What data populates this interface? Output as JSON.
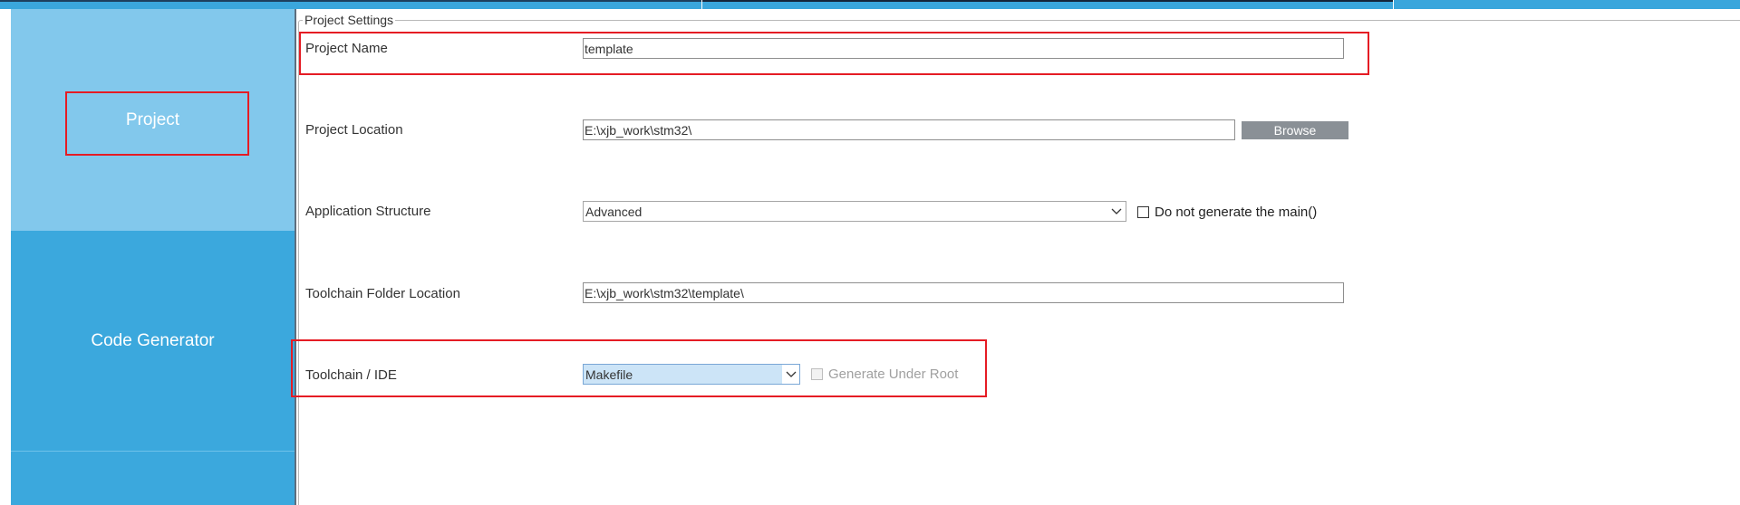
{
  "sidebar": {
    "tabs": [
      {
        "label": "Project",
        "active": true
      },
      {
        "label": "Code Generator",
        "active": false
      },
      {
        "label": "",
        "active": false
      }
    ]
  },
  "settings": {
    "legend": "Project Settings",
    "project_name": {
      "label": "Project Name",
      "value": "template"
    },
    "project_location": {
      "label": "Project Location",
      "value": "E:\\xjb_work\\stm32\\",
      "browse_label": "Browse"
    },
    "application_structure": {
      "label": "Application Structure",
      "selected": "Advanced",
      "checkbox_label": "Do not generate the main()",
      "checkbox_checked": false
    },
    "toolchain_folder": {
      "label": "Toolchain Folder Location",
      "value": "E:\\xjb_work\\stm32\\template\\"
    },
    "toolchain_ide": {
      "label": "Toolchain / IDE",
      "selected": "Makefile",
      "checkbox_label": "Generate Under Root",
      "checkbox_checked": false,
      "checkbox_disabled": true
    }
  },
  "colors": {
    "sidebar_bg": "#3ba8dd",
    "sidebar_active_bg": "#82c8ec",
    "annotation_red": "#e51c24",
    "browse_button_bg": "#8a9096",
    "select_highlight": "#cce4f7"
  },
  "icons": {
    "dropdown": "chevron-down-icon",
    "checkbox": "checkbox-icon"
  }
}
